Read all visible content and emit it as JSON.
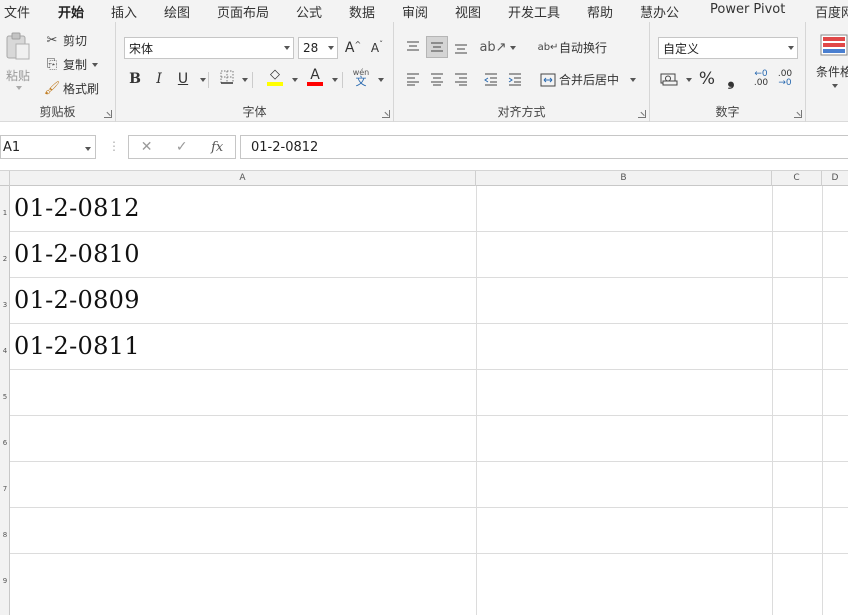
{
  "menu": {
    "tabs": [
      "文件",
      "开始",
      "插入",
      "绘图",
      "页面布局",
      "公式",
      "数据",
      "审阅",
      "视图",
      "开发工具",
      "帮助",
      "慧办公",
      "Power Pivot",
      "百度网"
    ]
  },
  "ribbon": {
    "clipboard": {
      "paste": "粘贴",
      "cut": "剪切",
      "copy": "复制",
      "format_painter": "格式刷",
      "label": "剪贴板"
    },
    "font": {
      "name": "宋体",
      "size": "28",
      "bold": "B",
      "italic": "I",
      "underline": "U",
      "grow": "A",
      "shrink": "A",
      "phonetic": "wén",
      "phonetic_sub": "文",
      "label": "字体"
    },
    "alignment": {
      "wrap": "自动换行",
      "merge": "合并后居中",
      "label": "对齐方式"
    },
    "number": {
      "format": "自定义",
      "percent": "%",
      "comma": "❟",
      "inc_dec": ".00",
      "dec_dec": ".00",
      "label": "数字"
    },
    "styles": {
      "conditional": "条件格"
    }
  },
  "formula_bar": {
    "name_box": "A1",
    "fx": "fx",
    "content": "01-2-0812"
  },
  "grid": {
    "columns": [
      "A",
      "B",
      "C",
      "D"
    ],
    "rows": [
      {
        "num": "1",
        "a": "01-2-0812"
      },
      {
        "num": "2",
        "a": "01-2-0810"
      },
      {
        "num": "3",
        "a": "01-2-0809"
      },
      {
        "num": "4",
        "a": "01-2-0811"
      },
      {
        "num": "5",
        "a": ""
      },
      {
        "num": "6",
        "a": ""
      },
      {
        "num": "7",
        "a": ""
      },
      {
        "num": "8",
        "a": ""
      },
      {
        "num": "9",
        "a": ""
      }
    ]
  },
  "colors": {
    "accent": "#217346",
    "font_highlight": "#ffff00",
    "font_color": "#ff0000"
  }
}
